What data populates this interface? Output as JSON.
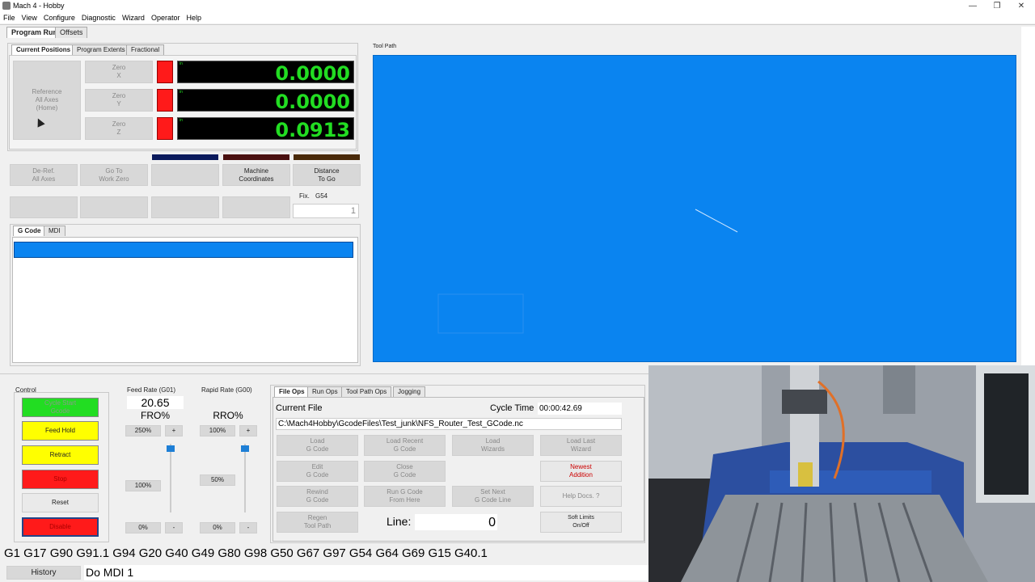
{
  "window": {
    "title": "Mach 4 - Hobby",
    "minimize": "—",
    "restore": "❐",
    "close": "✕"
  },
  "menu": [
    "File",
    "View",
    "Configure",
    "Diagnostic",
    "Wizard",
    "Operator",
    "Help"
  ],
  "main_tabs": [
    "Program Run",
    "Offsets"
  ],
  "position_tabs": [
    "Current Positions",
    "Program Extents",
    "Fractional"
  ],
  "reference_button": "Reference\nAll Axes\n(Home)",
  "axes": [
    {
      "zero_label": "Zero\nX",
      "unit": "in",
      "value": "0.0000"
    },
    {
      "zero_label": "Zero\nY",
      "unit": "in",
      "value": "0.0000"
    },
    {
      "zero_label": "Zero\nZ",
      "unit": "in",
      "value": "0.0913"
    }
  ],
  "buttons_row1": [
    "De-Ref.\nAll Axes",
    "Go To\nWork Zero",
    "",
    "Machine\nCoordinates",
    "Distance\nTo Go"
  ],
  "fixture": {
    "label": "Fix.",
    "value": "G54",
    "number": "1"
  },
  "gcode_tabs": [
    "G Code",
    "MDI"
  ],
  "toolpath_label": "Tool Path",
  "control": {
    "label": "Control",
    "buttons": [
      "Cycle Start\nGcode",
      "Feed Hold",
      "Retract",
      "Stop",
      "Reset",
      "Disable"
    ]
  },
  "feed": {
    "label": "Feed Rate (G01)",
    "value": "20.65",
    "override_label": "FRO%",
    "max": "250%",
    "plus": "+",
    "current": "100%",
    "min": "0%",
    "minus": "-",
    "level": 1.0
  },
  "rapid": {
    "label": "Rapid Rate (G00)",
    "override_label": "RRO%",
    "max": "100%",
    "plus": "+",
    "current": "50%",
    "min": "0%",
    "minus": "-",
    "level": 1.0
  },
  "file_tabs": [
    "File Ops",
    "Run Ops",
    "Tool Path Ops",
    "Jogging"
  ],
  "file": {
    "current_file_label": "Current File",
    "cycle_time_label": "Cycle Time",
    "cycle_time": "00:00:42.69",
    "path": "C:\\Mach4Hobby\\GcodeFiles\\Test_junk\\NFS_Router_Test_GCode.nc",
    "line_label": "Line:",
    "line_value": "0"
  },
  "file_buttons": [
    "Load\nG Code",
    "Load Recent\nG Code",
    "Load\nWizards",
    "Load Last\nWizard",
    "Edit\nG Code",
    "Close\nG Code",
    "",
    "Newest\nAddition",
    "Rewind\nG Code",
    "Run G Code\nFrom Here",
    "Set Next\nG Code Line",
    "Help Docs.  ?",
    "Regen\nTool Path",
    "Soft Limits\nOn/Off"
  ],
  "modal_line": "G1 G17 G90 G91.1 G94 G20 G40 G49 G80 G98 G50 G67 G97 G54 G64 G69 G15 G40.1",
  "history_button": "History",
  "mdi_status": "Do MDI 1",
  "colors": {
    "dro_green": "#22dd22",
    "toolpath_bg": "#0a84f0",
    "start_green": "#22dd22",
    "hold_yellow": "#ffff00",
    "stop_red": "#ff1a1a"
  }
}
